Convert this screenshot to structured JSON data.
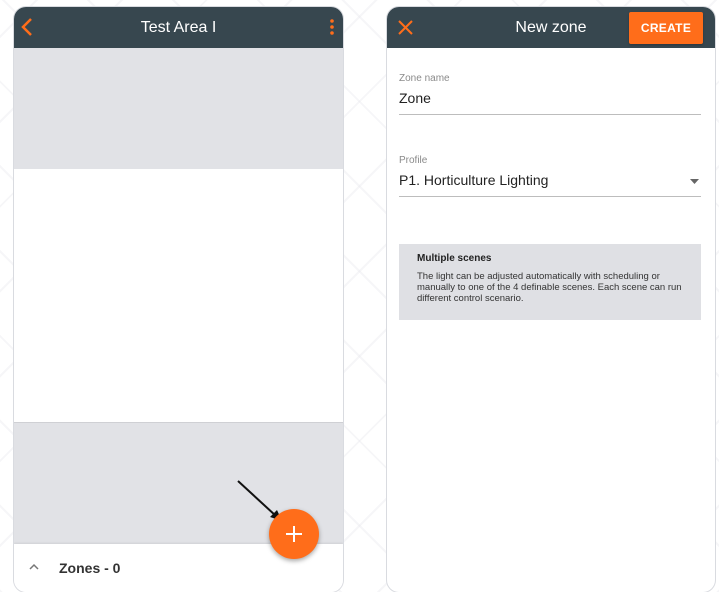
{
  "left_screen": {
    "title": "Test Area I",
    "back_icon": "chevron-left-icon",
    "more_icon": "more-vert-icon",
    "bottom_bar": {
      "label": "Zones - 0",
      "toggle_icon": "chevron-up-icon"
    },
    "fab": {
      "icon": "plus-icon"
    }
  },
  "right_screen": {
    "title": "New zone",
    "close_icon": "close-icon",
    "create_label": "CREATE",
    "zone_name": {
      "label": "Zone name",
      "value": "Zone"
    },
    "profile": {
      "label": "Profile",
      "value": "P1. Horticulture Lighting",
      "icon": "dropdown-arrow-icon"
    },
    "info": {
      "title": "Multiple scenes",
      "body": "The light can be adjusted automatically with scheduling or manually to one of the 4 definable scenes. Each scene can run different control scenario."
    }
  },
  "colors": {
    "appbar": "#37474f",
    "accent": "#ff6d1a",
    "panel_gray": "#e1e2e6"
  }
}
